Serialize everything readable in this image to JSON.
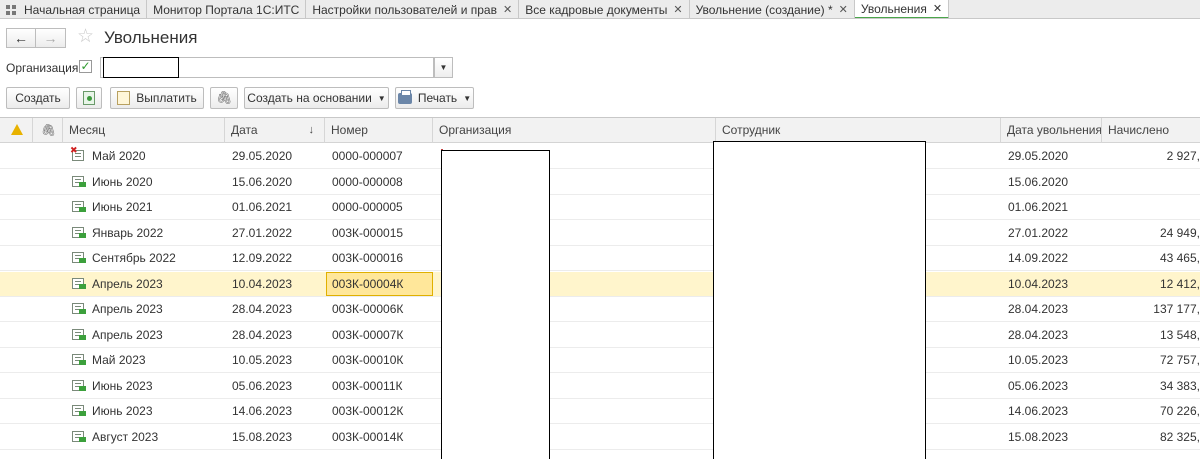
{
  "tabs": [
    {
      "label": "Начальная страница",
      "active": false,
      "closable": false,
      "icon": "grid-icon"
    },
    {
      "label": "Монитор Портала 1С:ИТС",
      "active": false,
      "closable": false
    },
    {
      "label": "Настройки пользователей и прав",
      "active": false,
      "closable": true
    },
    {
      "label": "Все кадровые документы",
      "active": false,
      "closable": true
    },
    {
      "label": "Увольнение (создание) *",
      "active": false,
      "closable": true
    },
    {
      "label": "Увольнения",
      "active": true,
      "closable": true
    }
  ],
  "header": {
    "back": "←",
    "forward": "→",
    "star": "☆",
    "title": "Увольнения"
  },
  "filter": {
    "org_label": "Организация:",
    "org_checked": "✓",
    "org_value": "",
    "dropdown_glyph": "▼"
  },
  "toolbar": {
    "create": "Создать",
    "pay": "Выплатить",
    "create_based": "Создать на основании",
    "print": "Печать",
    "caret": "▼",
    "clip_glyph": "🖇"
  },
  "columns": {
    "warn": "",
    "attach": "🖇",
    "month": "Месяц",
    "date": "Дата",
    "date_sort": "↓",
    "number": "Номер",
    "org": "Организация",
    "employee": "Сотрудник",
    "dismissal_date": "Дата увольнения",
    "accrued": "Начислено"
  },
  "rows": [
    {
      "month": "Май 2020",
      "date": "29.05.2020",
      "number": "0000-000007",
      "dismissal_date": "29.05.2020",
      "accrued": "2 927,",
      "deleted": true
    },
    {
      "month": "Июнь 2020",
      "date": "15.06.2020",
      "number": "0000-000008",
      "dismissal_date": "15.06.2020",
      "accrued": ""
    },
    {
      "month": "Июнь 2021",
      "date": "01.06.2021",
      "number": "0000-000005",
      "dismissal_date": "01.06.2021",
      "accrued": ""
    },
    {
      "month": "Январь 2022",
      "date": "27.01.2022",
      "number": "003К-000015",
      "dismissal_date": "27.01.2022",
      "accrued": "24 949,"
    },
    {
      "month": "Сентябрь 2022",
      "date": "12.09.2022",
      "number": "003К-000016",
      "dismissal_date": "14.09.2022",
      "accrued": "43 465,"
    },
    {
      "month": "Апрель 2023",
      "date": "10.04.2023",
      "number": "003К-00004К",
      "dismissal_date": "10.04.2023",
      "accrued": "12 412,",
      "selected": true
    },
    {
      "month": "Апрель 2023",
      "date": "28.04.2023",
      "number": "003К-00006К",
      "dismissal_date": "28.04.2023",
      "accrued": "137 177,"
    },
    {
      "month": "Апрель 2023",
      "date": "28.04.2023",
      "number": "003К-00007К",
      "dismissal_date": "28.04.2023",
      "accrued": "13 548,"
    },
    {
      "month": "Май 2023",
      "date": "10.05.2023",
      "number": "003К-00010К",
      "dismissal_date": "10.05.2023",
      "accrued": "72 757,"
    },
    {
      "month": "Июнь 2023",
      "date": "05.06.2023",
      "number": "003К-00011К",
      "dismissal_date": "05.06.2023",
      "accrued": "34 383,"
    },
    {
      "month": "Июнь 2023",
      "date": "14.06.2023",
      "number": "003К-00012К",
      "dismissal_date": "14.06.2023",
      "accrued": "70 226,"
    },
    {
      "month": "Август 2023",
      "date": "15.08.2023",
      "number": "003К-00014К",
      "dismissal_date": "15.08.2023",
      "accrued": "82 325,"
    }
  ],
  "colors": {
    "accent_green": "#4aa64a",
    "selected_row": "#fff5cc",
    "focus_cell": "#ffe79a",
    "warning": "#e8b200"
  }
}
